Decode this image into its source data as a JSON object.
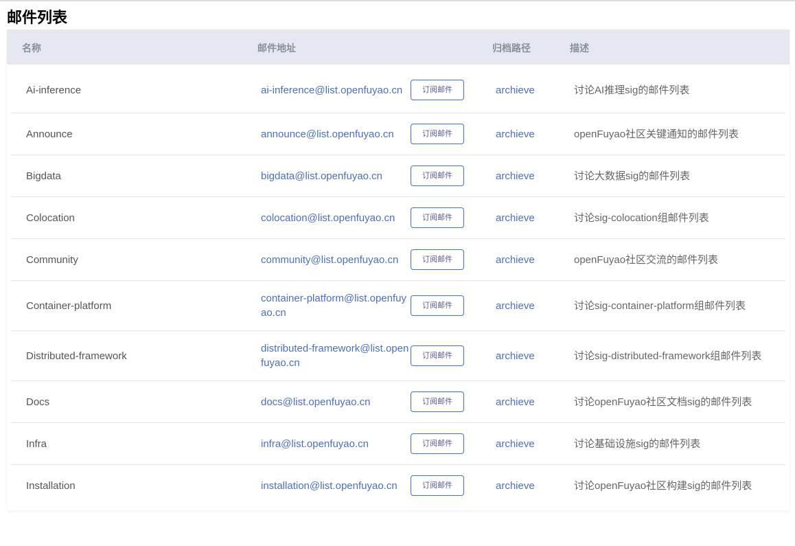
{
  "title": "邮件列表",
  "headers": {
    "name": "名称",
    "email": "邮件地址",
    "archive": "归档路径",
    "desc": "描述"
  },
  "rows": [
    {
      "name": "Ai-inference",
      "email": "ai-inference@list.openfuyao.cn",
      "button": "订阅邮件",
      "archive": "archieve",
      "desc": "讨论AI推理sig的邮件列表"
    },
    {
      "name": "Announce",
      "email": "announce@list.openfuyao.cn",
      "button": "订阅邮件",
      "archive": "archieve",
      "desc": "openFuyao社区关键通知的邮件列表"
    },
    {
      "name": "Bigdata",
      "email": "bigdata@list.openfuyao.cn",
      "button": "订阅邮件",
      "archive": "archieve",
      "desc": "讨论大数据sig的邮件列表"
    },
    {
      "name": "Colocation",
      "email": "colocation@list.openfuyao.cn",
      "button": "订阅邮件",
      "archive": "archieve",
      "desc": "讨论sig-colocation组邮件列表"
    },
    {
      "name": "Community",
      "email": "community@list.openfuyao.cn",
      "button": "订阅邮件",
      "archive": "archieve",
      "desc": "openFuyao社区交流的邮件列表"
    },
    {
      "name": "Container-platform",
      "email": "container-platform@list.openfuyao.cn",
      "button": "订阅邮件",
      "archive": "archieve",
      "desc": "讨论sig-container-platform组邮件列表"
    },
    {
      "name": "Distributed-framework",
      "email": "distributed-framework@list.openfuyao.cn",
      "button": "订阅邮件",
      "archive": "archieve",
      "desc": "讨论sig-distributed-framework组邮件列表"
    },
    {
      "name": "Docs",
      "email": "docs@list.openfuyao.cn",
      "button": "订阅邮件",
      "archive": "archieve",
      "desc": "讨论openFuyao社区文档sig的邮件列表"
    },
    {
      "name": "Infra",
      "email": "infra@list.openfuyao.cn",
      "button": "订阅邮件",
      "archive": "archieve",
      "desc": "讨论基础设施sig的邮件列表"
    },
    {
      "name": "Installation",
      "email": "installation@list.openfuyao.cn",
      "button": "订阅邮件",
      "archive": "archieve",
      "desc": "讨论openFuyao社区构建sig的邮件列表"
    }
  ]
}
